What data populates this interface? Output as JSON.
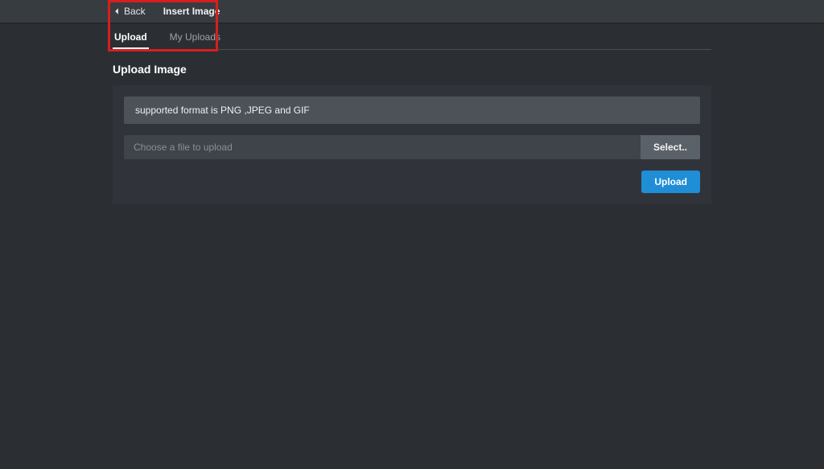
{
  "header": {
    "back_label": "Back",
    "title": "Insert Image"
  },
  "tabs": {
    "upload": "Upload",
    "my_uploads": "My Uploads"
  },
  "page": {
    "heading": "Upload Image",
    "info": "supported format is PNG ,JPEG and GIF",
    "file_placeholder": "Choose a file to upload",
    "select_label": "Select..",
    "upload_label": "Upload"
  }
}
